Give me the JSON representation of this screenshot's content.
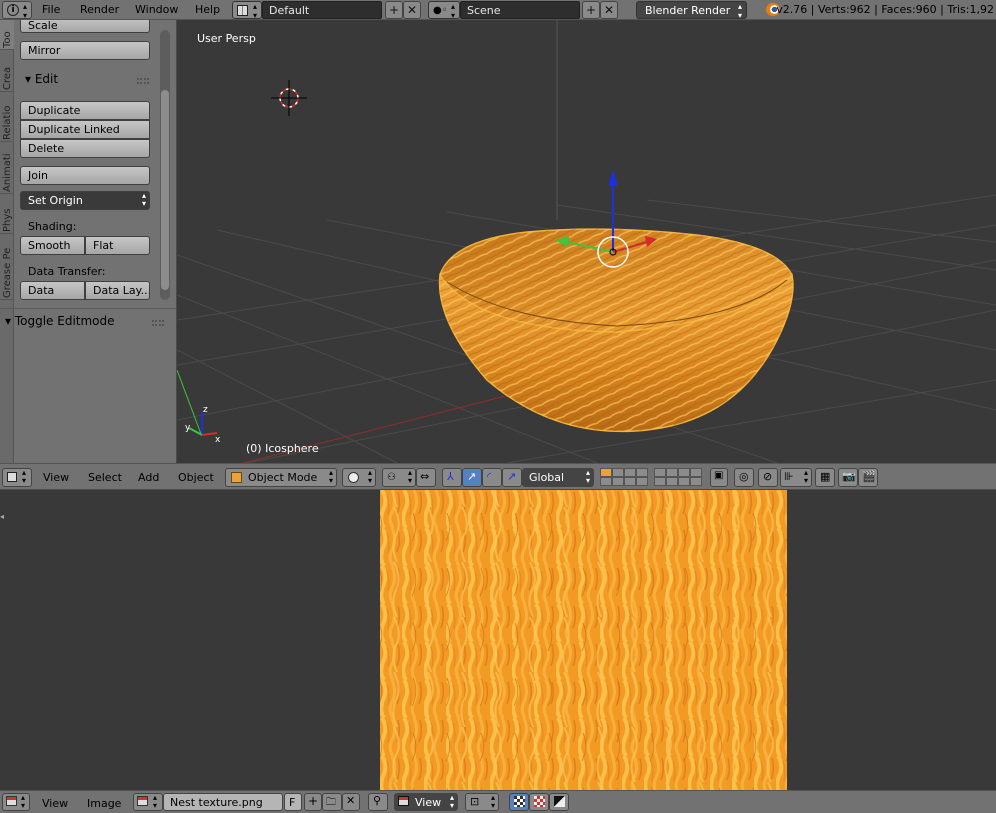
{
  "topbar": {
    "info_icon": "info-icon",
    "menus": [
      "File",
      "Render",
      "Window",
      "Help"
    ],
    "screen_layout": "Default",
    "scene": "Scene",
    "render_engine": "Blender Render",
    "stats": "v2.76 | Verts:962 | Faces:960 | Tris:1,92"
  },
  "toolshelf": {
    "tabs": [
      "Too",
      "Crea",
      "Relatio",
      "Animati",
      "Phys",
      "Grease Pe"
    ],
    "scale_label": "Scale",
    "mirror_label": "Mirror",
    "edit_header": "Edit",
    "duplicate_label": "Duplicate",
    "duplicate_linked_label": "Duplicate Linked",
    "delete_label": "Delete",
    "join_label": "Join",
    "set_origin_label": "Set Origin",
    "shading_label": "Shading:",
    "smooth_label": "Smooth",
    "flat_label": "Flat",
    "data_transfer_label": "Data Transfer:",
    "data_label": "Data",
    "data_layers_label": "Data Lay...",
    "toggle_editmode_header": "Toggle Editmode"
  },
  "viewport": {
    "view_name": "User Persp",
    "object_name": "(0) Icosphere",
    "colors": {
      "background": "#393939",
      "grid": "#4a4a4a",
      "bowl": "#e89a2c",
      "axis_x": "#d62b2b",
      "axis_y": "#3ec43e",
      "axis_z": "#1e2fe0"
    }
  },
  "header3d": {
    "menus": [
      "View",
      "Select",
      "Add",
      "Object"
    ],
    "mode": "Object Mode",
    "orientation": "Global"
  },
  "image_editor": {
    "colors": {
      "texture_base": "#f39a25",
      "texture_light": "#fbbf4a",
      "texture_dark": "#d8761a"
    }
  },
  "header_image": {
    "menus": [
      "View",
      "Image"
    ],
    "image_name": "Nest texture.png",
    "fake_user": "F",
    "view_label": "View"
  }
}
